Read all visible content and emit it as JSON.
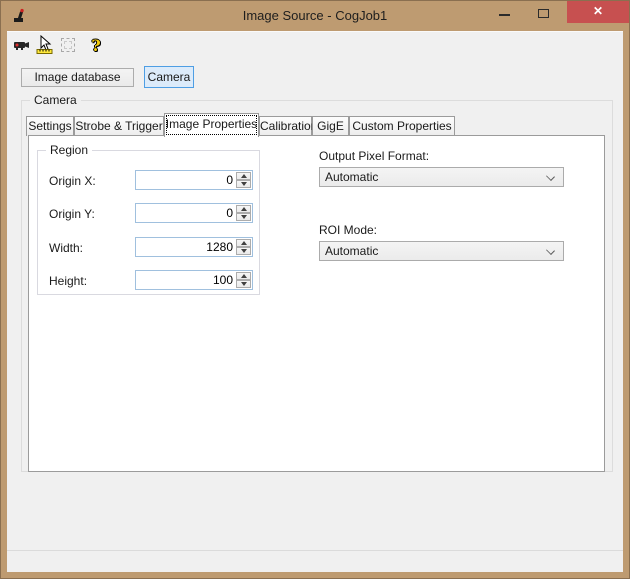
{
  "window": {
    "title": "Image Source - CogJob1",
    "close_glyph": "✕"
  },
  "colors": {
    "titlebar": "#BE9B71",
    "close_button": "#C75050",
    "client_bg": "#F0F0F0",
    "camera_button_bg": "#DCEBFA",
    "camera_button_border": "#4E9EE4",
    "numeric_field_border": "#A0C0DE",
    "tab_border": "#9B9B9B"
  },
  "toolbar": {
    "icons": [
      {
        "name": "camera-icon"
      },
      {
        "name": "pointer-ruler-icon"
      },
      {
        "name": "marquee-disabled-icon"
      },
      {
        "name": "help-icon",
        "glyph": "?"
      }
    ]
  },
  "source_selector": {
    "image_database_label": "Image database",
    "camera_label": "Camera",
    "selected": "Camera"
  },
  "camera_group": {
    "label": "Camera"
  },
  "tabs": {
    "selected": "Image Properties",
    "items": [
      {
        "label": "Settings"
      },
      {
        "label": "Strobe & Trigger"
      },
      {
        "label": "Image Properties"
      },
      {
        "label": "Calibration"
      },
      {
        "label": "GigE"
      },
      {
        "label": "Custom Properties"
      }
    ]
  },
  "region": {
    "label": "Region",
    "fields": [
      {
        "label": "Origin X:",
        "value": "0"
      },
      {
        "label": "Origin Y:",
        "value": "0"
      },
      {
        "label": "Width:",
        "value": "1280"
      },
      {
        "label": "Height:",
        "value": "100"
      }
    ]
  },
  "output_pixel_format": {
    "label": "Output Pixel Format:",
    "value": "Automatic"
  },
  "roi_mode": {
    "label": "ROI Mode:",
    "value": "Automatic"
  }
}
